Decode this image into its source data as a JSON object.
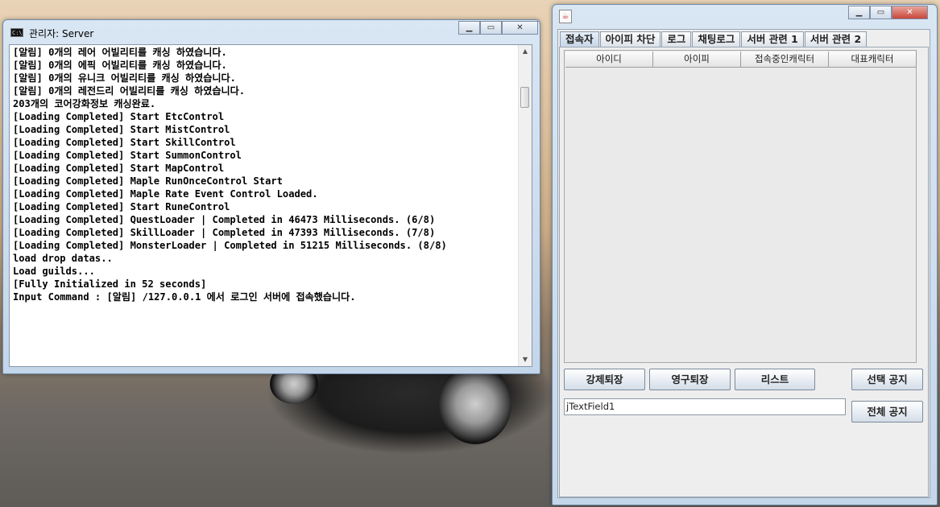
{
  "console": {
    "title": "관리자:  Server",
    "lines": [
      "[알림] 0개의 레어 어빌리티를 캐싱 하였습니다.",
      "[알림] 0개의 에픽 어빌리티를 캐싱 하였습니다.",
      "[알림] 0개의 유니크 어빌리티를 캐싱 하였습니다.",
      "[알림] 0개의 레전드리 어빌리티를 캐싱 하였습니다.",
      "203개의 코어강화정보 캐싱완료.",
      "[Loading Completed] Start EtcControl",
      "[Loading Completed] Start MistControl",
      "[Loading Completed] Start SkillControl",
      "[Loading Completed] Start SummonControl",
      "[Loading Completed] Start MapControl",
      "[Loading Completed] Maple RunOnceControl Start",
      "[Loading Completed] Maple Rate Event Control Loaded.",
      "[Loading Completed] Start RuneControl",
      "[Loading Completed] QuestLoader | Completed in 46473 Milliseconds. (6/8)",
      "[Loading Completed] SkillLoader | Completed in 47393 Milliseconds. (7/8)",
      "[Loading Completed] MonsterLoader | Completed in 51215 Milliseconds. (8/8)",
      "load drop datas..",
      "Load guilds...",
      "[Fully Initialized in 52 seconds]",
      "Input Command : [알림] /127.0.0.1 에서 로그인 서버에 접속했습니다."
    ]
  },
  "java_window": {
    "tabs": [
      "접속자",
      "아이피 차단",
      "로그",
      "채팅로그",
      "서버 관련 1",
      "서버 관련 2"
    ],
    "table_headers": [
      "아이디",
      "아이피",
      "접속중인캐릭터",
      "대표캐릭터"
    ],
    "buttons": {
      "kick": "강제퇴장",
      "ban": "영구퇴장",
      "list": "리스트",
      "select_notice": "선택 공지",
      "all_notice": "전체 공지"
    },
    "text_field_value": "jTextField1"
  }
}
